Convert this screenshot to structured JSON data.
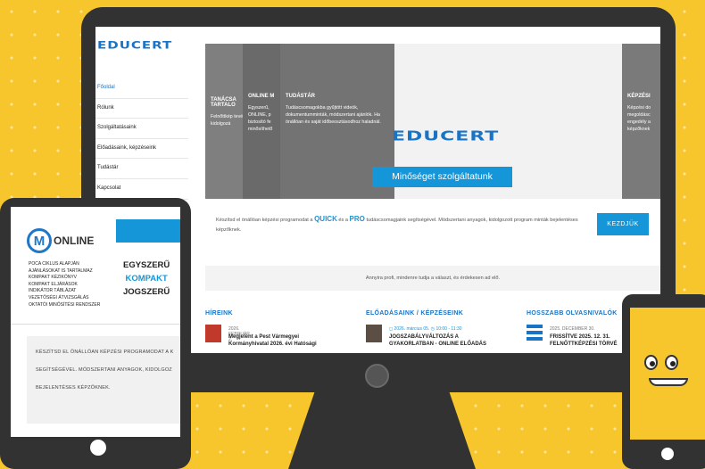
{
  "brand": "EDUCERT",
  "nav": [
    {
      "label": "Főoldal",
      "active": true
    },
    {
      "label": "Rólunk"
    },
    {
      "label": "Szolgáltatásaink"
    },
    {
      "label": "Előadásaink, képzéseink"
    },
    {
      "label": "Tudástár"
    },
    {
      "label": "Kapcsolat"
    }
  ],
  "hero": {
    "p1": {
      "heading": "TANÁCSA TARTALO",
      "text": "Felnőttkép tevékenys kidolgozá"
    },
    "p2": {
      "heading": "ONLINE M",
      "text": "Egyszerű, ONLINE, p biztosító fe minősíthető"
    },
    "p3": {
      "heading": "TUDÁSTÁR",
      "text": "Tudáscsomagokba gyűjtött videók, dokumentumminták, módszertani ajánlók. Ha önállóan és saját időbeosztásodhoz haladnál."
    },
    "p4": {
      "heading": "KÉPZÉSI",
      "text": "Képzési do megoldásc engedély a képzőknek"
    },
    "logo": "EDUCERT",
    "tagline": "Minőséget szolgáltatunk"
  },
  "intro": {
    "pre": "Készítsd el önállóan képzési programodat a ",
    "quick": "QUICK",
    "mid": " és a ",
    "pro": "PRO",
    "post": " tudáscsomagjaink segítségével. Módszertani anyagok, kidolgozott program minták bejelentéses képzőknek."
  },
  "cta": "KEZDJÜK",
  "band": "Annyira profi, mindenre tudja a választ, és érdekesen ad elő.",
  "news": {
    "hireink": {
      "heading": "HÍREINK",
      "date": "2026. FEBRUÁR 2.",
      "title1": "Megjelent a Pest Vármegyei",
      "title2": "Kormányhivatal 2026. évi Hatósági"
    },
    "eloadasaink": {
      "heading": "ELŐADÁSAINK / KÉPZÉSEINK",
      "date": "2026. március 05.",
      "time": "10:00 - 11:30",
      "title1": "JOGSZABÁLYVÁLTOZÁS A",
      "title2": "GYAKORLATBAN - ONLINE ELŐADÁS"
    },
    "olvasnivalok": {
      "heading": "HOSSZABB OLVASNIVALÓK",
      "date": "2025. DECEMBER 30.",
      "title1": "FRISSÍTVE 2025. 12. 31.",
      "title2": "FELNŐTTKÉPZÉSI TÖRVÉ"
    }
  },
  "tablet": {
    "brand": "ONLINE",
    "list": [
      "POCA CIKLUS ALAPJÁN",
      "AJÁNLÁSOKAT IS TARTALMAZ",
      "KOMPAKT KÉZIKÖNYV",
      "KOMPAKT ELJÁRÁSOK",
      "INDIKÁTOR TÁBLÁZAT",
      "VEZETŐSÉGI ÁTVIZSGÁLÁS",
      "OKTATÓI MINŐSÍTÉSI RENDSZER"
    ],
    "stack": [
      "EGYSZERŰ",
      "KOMPAKT",
      "JOGSZERŰ"
    ],
    "box": [
      "KÉSZÍTSD EL ÖNÁLLÓAN KÉPZÉSI PROGRAMODAT A K",
      "SEGÍTSÉGÉVEL. MÓDSZERTANI ANYAGOK, KIDOLGOZ",
      "BEJELENTÉSES KÉPZŐKNEK."
    ]
  },
  "colors": {
    "accent": "#1596d8",
    "brand": "#1a74c6",
    "background": "#f6c62c",
    "device": "#323232"
  }
}
